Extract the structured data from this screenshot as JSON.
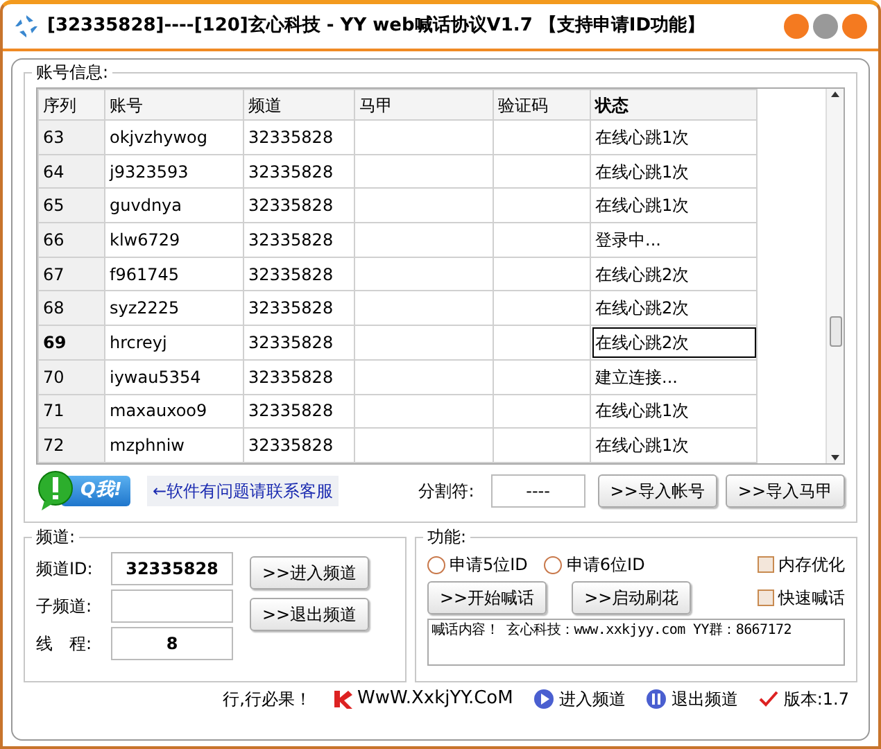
{
  "window": {
    "title": "[32335828]----[120]玄心科技 - YY web喊话协议V1.7 【支持申请ID功能】"
  },
  "accounts": {
    "label": "账号信息:",
    "columns": [
      "序列",
      "账号",
      "频道",
      "马甲",
      "验证码",
      "状态"
    ],
    "rows": [
      {
        "cells": [
          "63",
          "okjvzhywog",
          "32335828",
          "",
          "",
          "在线心跳1次"
        ],
        "selected": false
      },
      {
        "cells": [
          "64",
          "j9323593",
          "32335828",
          "",
          "",
          "在线心跳1次"
        ],
        "selected": false
      },
      {
        "cells": [
          "65",
          "guvdnya",
          "32335828",
          "",
          "",
          "在线心跳1次"
        ],
        "selected": false
      },
      {
        "cells": [
          "66",
          "klw6729",
          "32335828",
          "",
          "",
          "登录中..."
        ],
        "selected": false
      },
      {
        "cells": [
          "67",
          "f961745",
          "32335828",
          "",
          "",
          "在线心跳2次"
        ],
        "selected": false
      },
      {
        "cells": [
          "68",
          "syz2225",
          "32335828",
          "",
          "",
          "在线心跳2次"
        ],
        "selected": false
      },
      {
        "cells": [
          "69",
          "hrcreyj",
          "32335828",
          "",
          "",
          "在线心跳2次"
        ],
        "selected": true
      },
      {
        "cells": [
          "70",
          "iywau5354",
          "32335828",
          "",
          "",
          "建立连接..."
        ],
        "selected": false
      },
      {
        "cells": [
          "71",
          "maxauxoo9",
          "32335828",
          "",
          "",
          "在线心跳1次"
        ],
        "selected": false
      },
      {
        "cells": [
          "72",
          "mzphniw",
          "32335828",
          "",
          "",
          "在线心跳1次"
        ],
        "selected": false
      }
    ]
  },
  "toolbar": {
    "qq_badge": "Q我!",
    "help_link": "←软件有问题请联系客服",
    "separator_label": "分割符:",
    "separator_value": "----",
    "buttons": [
      ">>导入帐号",
      ">>导入马甲"
    ]
  },
  "channel": {
    "label": "频道:",
    "fields": [
      {
        "label": "频道ID:",
        "value": "32335828"
      },
      {
        "label": "子频道:"
      },
      {
        "label": "线　程:",
        "value": "8"
      }
    ],
    "buttons": [
      ">>进入频道",
      ">>退出频道"
    ]
  },
  "functions": {
    "label": "功能:",
    "radios": [
      {
        "label": "申请5位ID",
        "selected": false
      },
      {
        "label": "申请6位ID",
        "selected": false
      }
    ],
    "checkboxes": [
      {
        "label": "内存优化",
        "checked": false
      },
      {
        "label": "快速喊话",
        "checked": false
      }
    ],
    "buttons": [
      ">>开始喊话",
      ">>启动刷花"
    ],
    "message": "喊话内容！ 玄心科技：www.xxkjyy.com YY群：8667172"
  },
  "status_bar": [
    {
      "kind": "text",
      "text": "行,行必果！"
    },
    {
      "kind": "site",
      "text": "WwW.XxkjYY.CoM"
    },
    {
      "kind": "play",
      "text": "进入频道"
    },
    {
      "kind": "pause",
      "text": "退出频道"
    },
    {
      "kind": "check",
      "text": "版本:1.7"
    }
  ]
}
